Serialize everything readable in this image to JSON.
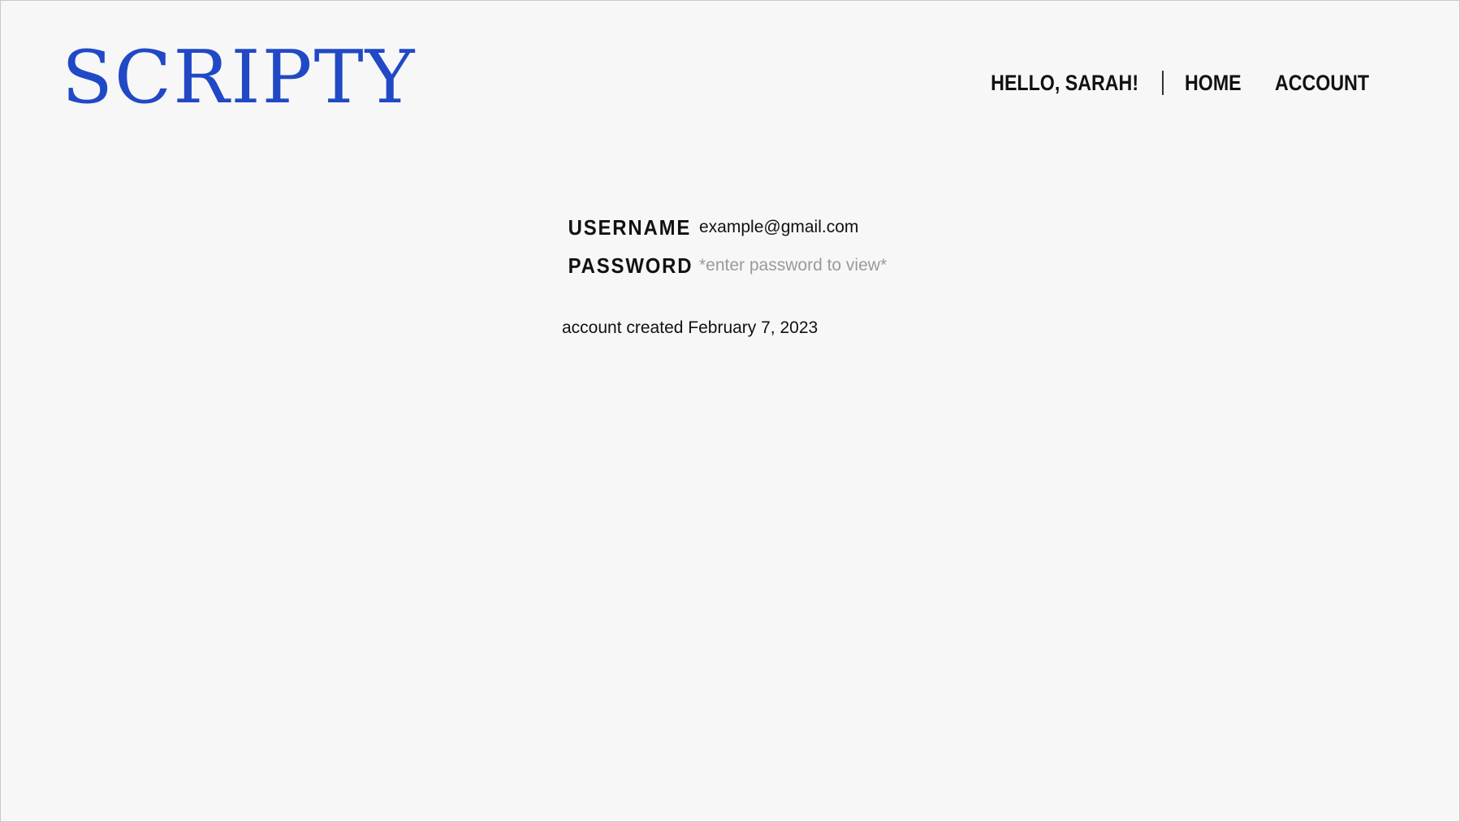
{
  "brand": {
    "logo_text": "SCRIPTY",
    "color": "#2149c6"
  },
  "nav": {
    "greeting": "HELLO, SARAH!",
    "home_label": "HOME",
    "account_label": "ACCOUNT"
  },
  "account": {
    "username_label": "USERNAME",
    "username_value": "example@gmail.com",
    "password_label": "PASSWORD",
    "password_placeholder": "*enter password to view*",
    "created_text": "account created February 7, 2023"
  }
}
